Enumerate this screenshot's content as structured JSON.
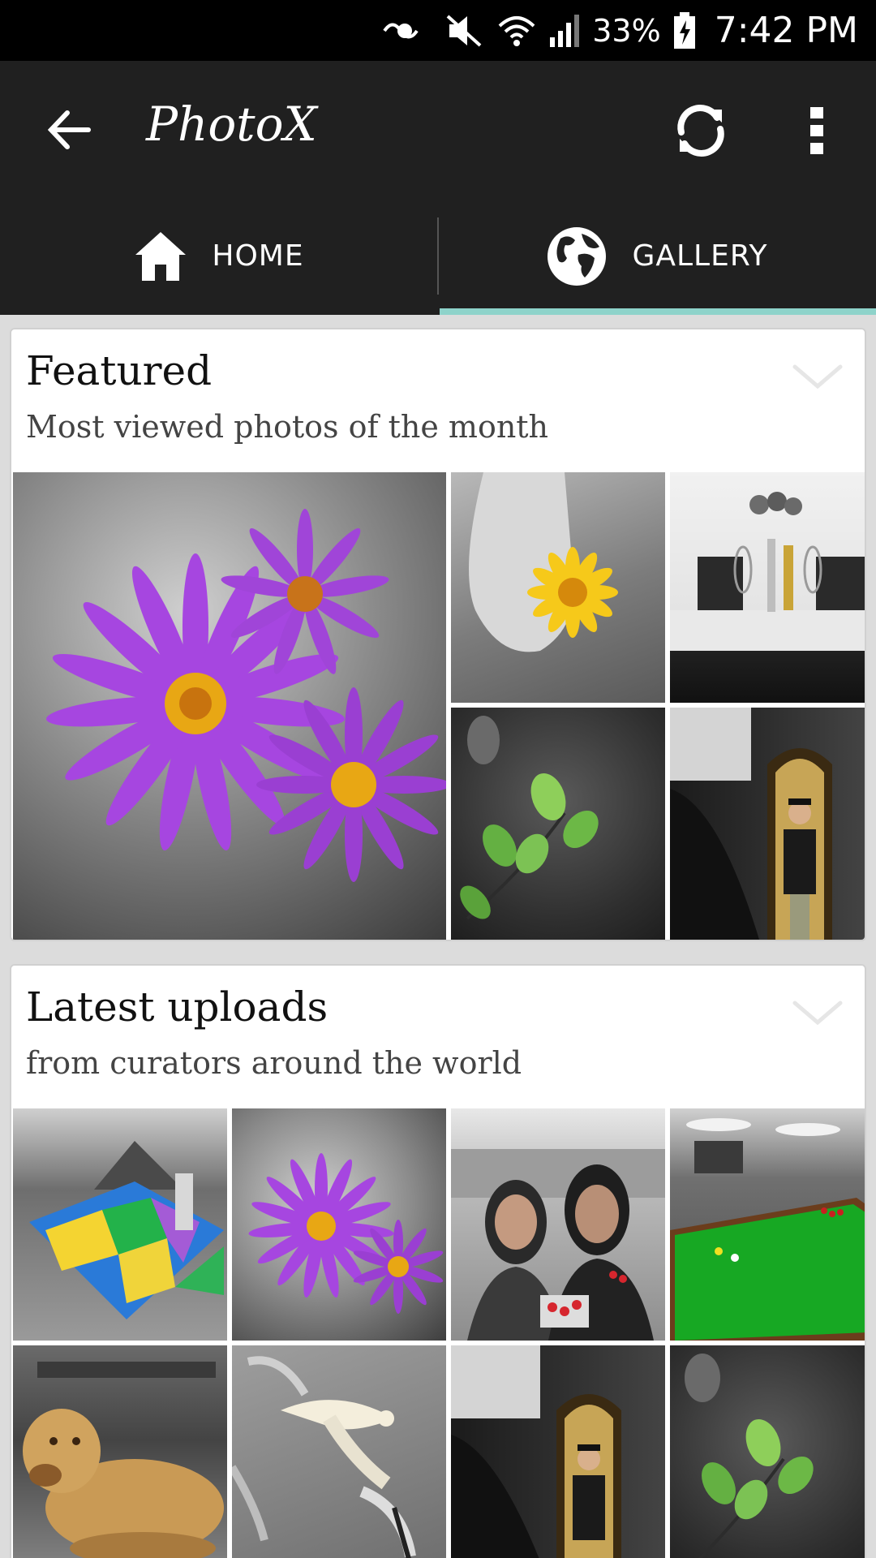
{
  "status_bar": {
    "battery": "33%",
    "time": "7:42 PM"
  },
  "action_bar": {
    "title": "PhotoX"
  },
  "tabs": [
    {
      "label": "HOME",
      "icon": "home-icon"
    },
    {
      "label": "GALLERY",
      "icon": "globe-icon"
    }
  ],
  "featured": {
    "title": "Featured",
    "subtitle": "Most viewed photos of the month"
  },
  "latest": {
    "title": "Latest uploads",
    "subtitle": "from curators around the world"
  },
  "colors": {
    "action_bar": "#202020",
    "tab_indicator": "#8ed3ca",
    "background": "#dcdcdc"
  }
}
